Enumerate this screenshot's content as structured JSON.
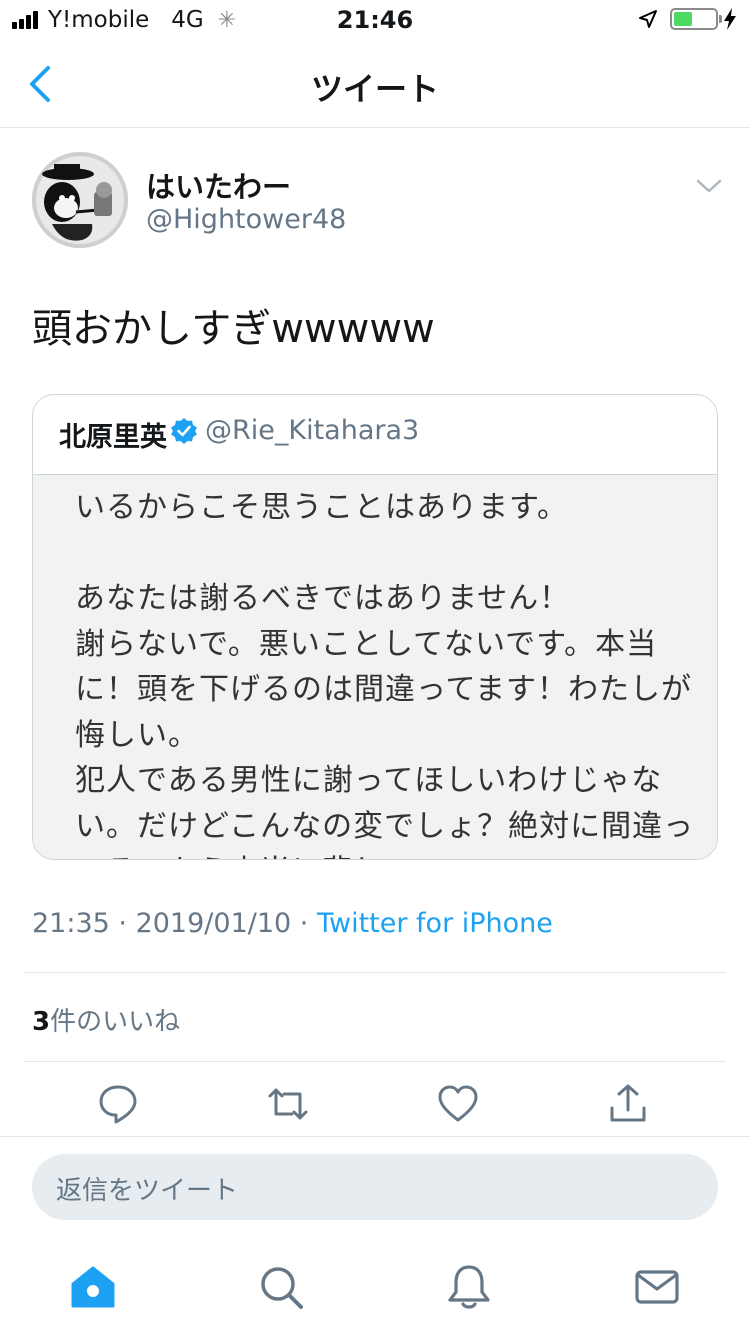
{
  "status_bar": {
    "carrier": "Y!mobile",
    "network": "4G",
    "time": "21:46",
    "battery_level": 0.45
  },
  "nav": {
    "title": "ツイート"
  },
  "tweet": {
    "display_name": "はいたわー",
    "handle": "@Hightower48",
    "text": "頭おかしすぎwwwww",
    "time": "21:35",
    "date": "2019/01/10",
    "source": "Twitter for iPhone",
    "likes_count": "3",
    "likes_label": "件のいいね"
  },
  "quoted_tweet": {
    "display_name": "北原里英",
    "handle": "@Rie_Kitahara3",
    "image_text_lines": [
      "いるからこそ思うことはあります。",
      "",
      "あなたは謝るべきではありません！",
      "謝らないで。悪いことしてないです。本当",
      "に！頭を下げるのは間違ってます！わたしが",
      "悔しい。",
      "犯人である男性に謝ってほしいわけじゃな",
      "い。だけどこんなの変でしょ？絶対に間違っ",
      "てる。もう本当に悲しい"
    ]
  },
  "reply": {
    "placeholder": "返信をツイート"
  },
  "colors": {
    "accent": "#1da1f2",
    "text": "#14171a",
    "secondary": "#657786",
    "divider": "#e1e8ed",
    "battery": "#4cd964"
  },
  "icons": {
    "back": "chevron-left-icon",
    "caret": "chevron-down-icon",
    "verified": "verified-badge-icon",
    "reply": "reply-icon",
    "retweet": "retweet-icon",
    "like": "heart-icon",
    "share": "share-icon",
    "home": "home-icon",
    "search": "search-icon",
    "notifications": "bell-icon",
    "messages": "mail-icon"
  }
}
